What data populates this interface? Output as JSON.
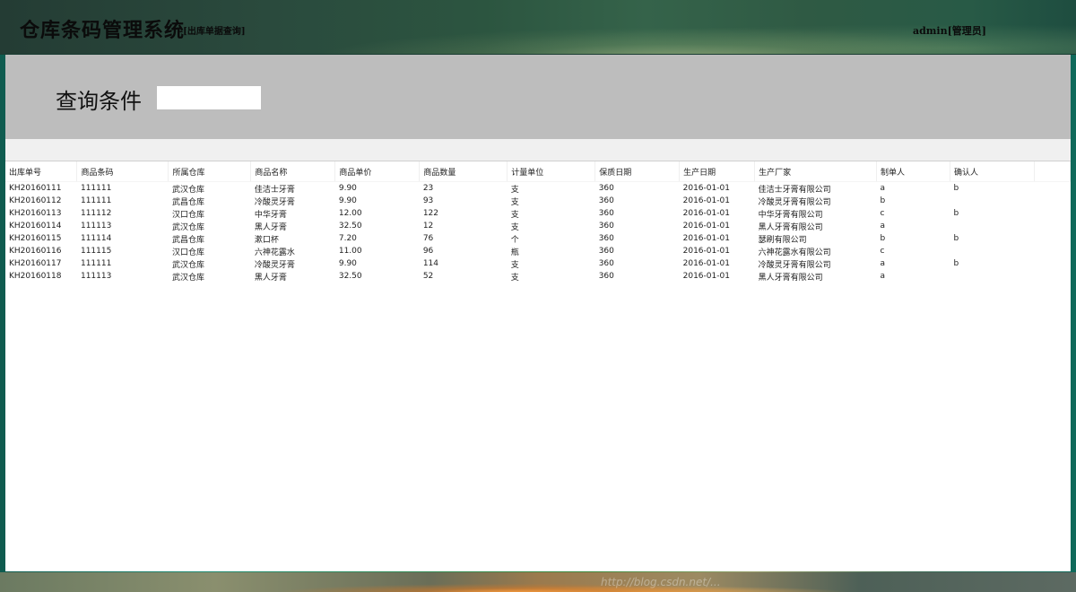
{
  "header": {
    "title": "仓库条码管理系统",
    "subtitle": "-[出库单据查询]",
    "user": "admin[管理员]"
  },
  "query": {
    "label": "查询条件",
    "value": ""
  },
  "table": {
    "columns": [
      "出库单号",
      "商品条码",
      "所属仓库",
      "商品名称",
      "商品单价",
      "商品数量",
      "计量单位",
      "保质日期",
      "生产日期",
      "生产厂家",
      "制单人",
      "确认人"
    ],
    "rows": [
      [
        "KH20160111",
        "111111",
        "武汉仓库",
        "佳洁士牙膏",
        "9.90",
        "23",
        "支",
        "360",
        "2016-01-01",
        "佳洁士牙膏有限公司",
        "a",
        "b"
      ],
      [
        "KH20160112",
        "111111",
        "武昌仓库",
        "冷酸灵牙膏",
        "9.90",
        "93",
        "支",
        "360",
        "2016-01-01",
        "冷酸灵牙膏有限公司",
        "b",
        ""
      ],
      [
        "KH20160113",
        "111112",
        "汉口仓库",
        "中华牙膏",
        "12.00",
        "122",
        "支",
        "360",
        "2016-01-01",
        "中华牙膏有限公司",
        "c",
        "b"
      ],
      [
        "KH20160114",
        "111113",
        "武汉仓库",
        "黑人牙膏",
        "32.50",
        "12",
        "支",
        "360",
        "2016-01-01",
        "黑人牙膏有限公司",
        "a",
        ""
      ],
      [
        "KH20160115",
        "111114",
        "武昌仓库",
        "漱口杯",
        "7.20",
        "76",
        "个",
        "360",
        "2016-01-01",
        "瑟刷有限公司",
        "b",
        "b"
      ],
      [
        "KH20160116",
        "111115",
        "汉口仓库",
        "六神花露水",
        "11.00",
        "96",
        "瓶",
        "360",
        "2016-01-01",
        "六神花露水有限公司",
        "c",
        ""
      ],
      [
        "KH20160117",
        "111111",
        "武汉仓库",
        "冷酸灵牙膏",
        "9.90",
        "114",
        "支",
        "360",
        "2016-01-01",
        "冷酸灵牙膏有限公司",
        "a",
        "b"
      ],
      [
        "KH20160118",
        "111113",
        "武汉仓库",
        "黑人牙膏",
        "32.50",
        "52",
        "支",
        "360",
        "2016-01-01",
        "黑人牙膏有限公司",
        "a",
        ""
      ]
    ]
  },
  "footer": {
    "watermark": "http://blog.csdn.net/..."
  }
}
